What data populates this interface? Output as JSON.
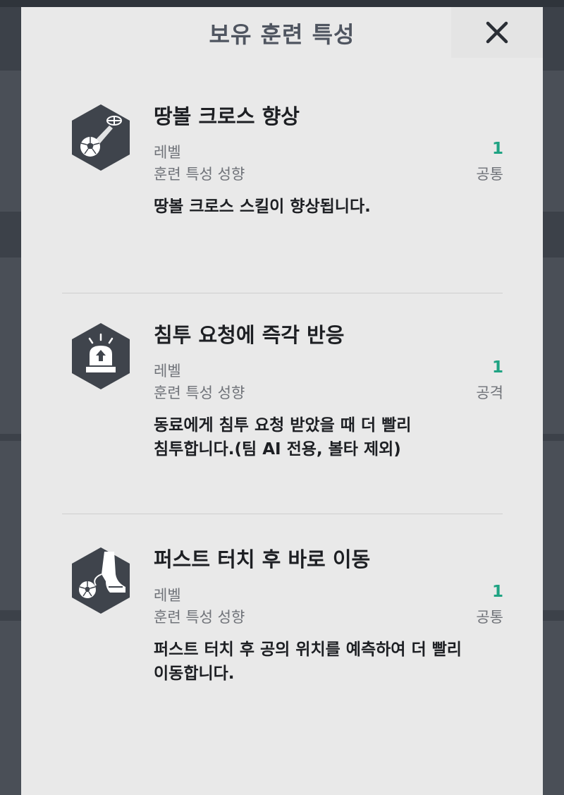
{
  "modal": {
    "title": "보유 훈련 특성"
  },
  "traits": [
    {
      "name": "땅볼 크로스 향상",
      "level_label": "레벨",
      "level_value": "1",
      "tendency_label": "훈련 특성 성향",
      "tendency_value": "공통",
      "description_lines": [
        "땅볼 크로스 스킬이 향상됩니다."
      ],
      "icon": "ground-cross-icon"
    },
    {
      "name": "침투 요청에 즉각 반응",
      "level_label": "레벨",
      "level_value": "1",
      "tendency_label": "훈련 특성 성향",
      "tendency_value": "공격",
      "description_lines": [
        "동료에게 침투 요청 받았을 때 더 빨리",
        "침투합니다.(팀 AI 전용, 볼타 제외)"
      ],
      "icon": "alarm-siren-icon"
    },
    {
      "name": "퍼스트 터치 후 바로 이동",
      "level_label": "레벨",
      "level_value": "1",
      "tendency_label": "훈련 특성 성향",
      "tendency_value": "공통",
      "description_lines": [
        "퍼스트 터치 후 공의 위치를 예측하여 더 빨리",
        "이동합니다."
      ],
      "icon": "first-touch-boot-icon"
    }
  ],
  "colors": {
    "accent_level": "#1fa383",
    "icon_hex": "#3f444c",
    "modal_bg": "#e9e9e9"
  }
}
